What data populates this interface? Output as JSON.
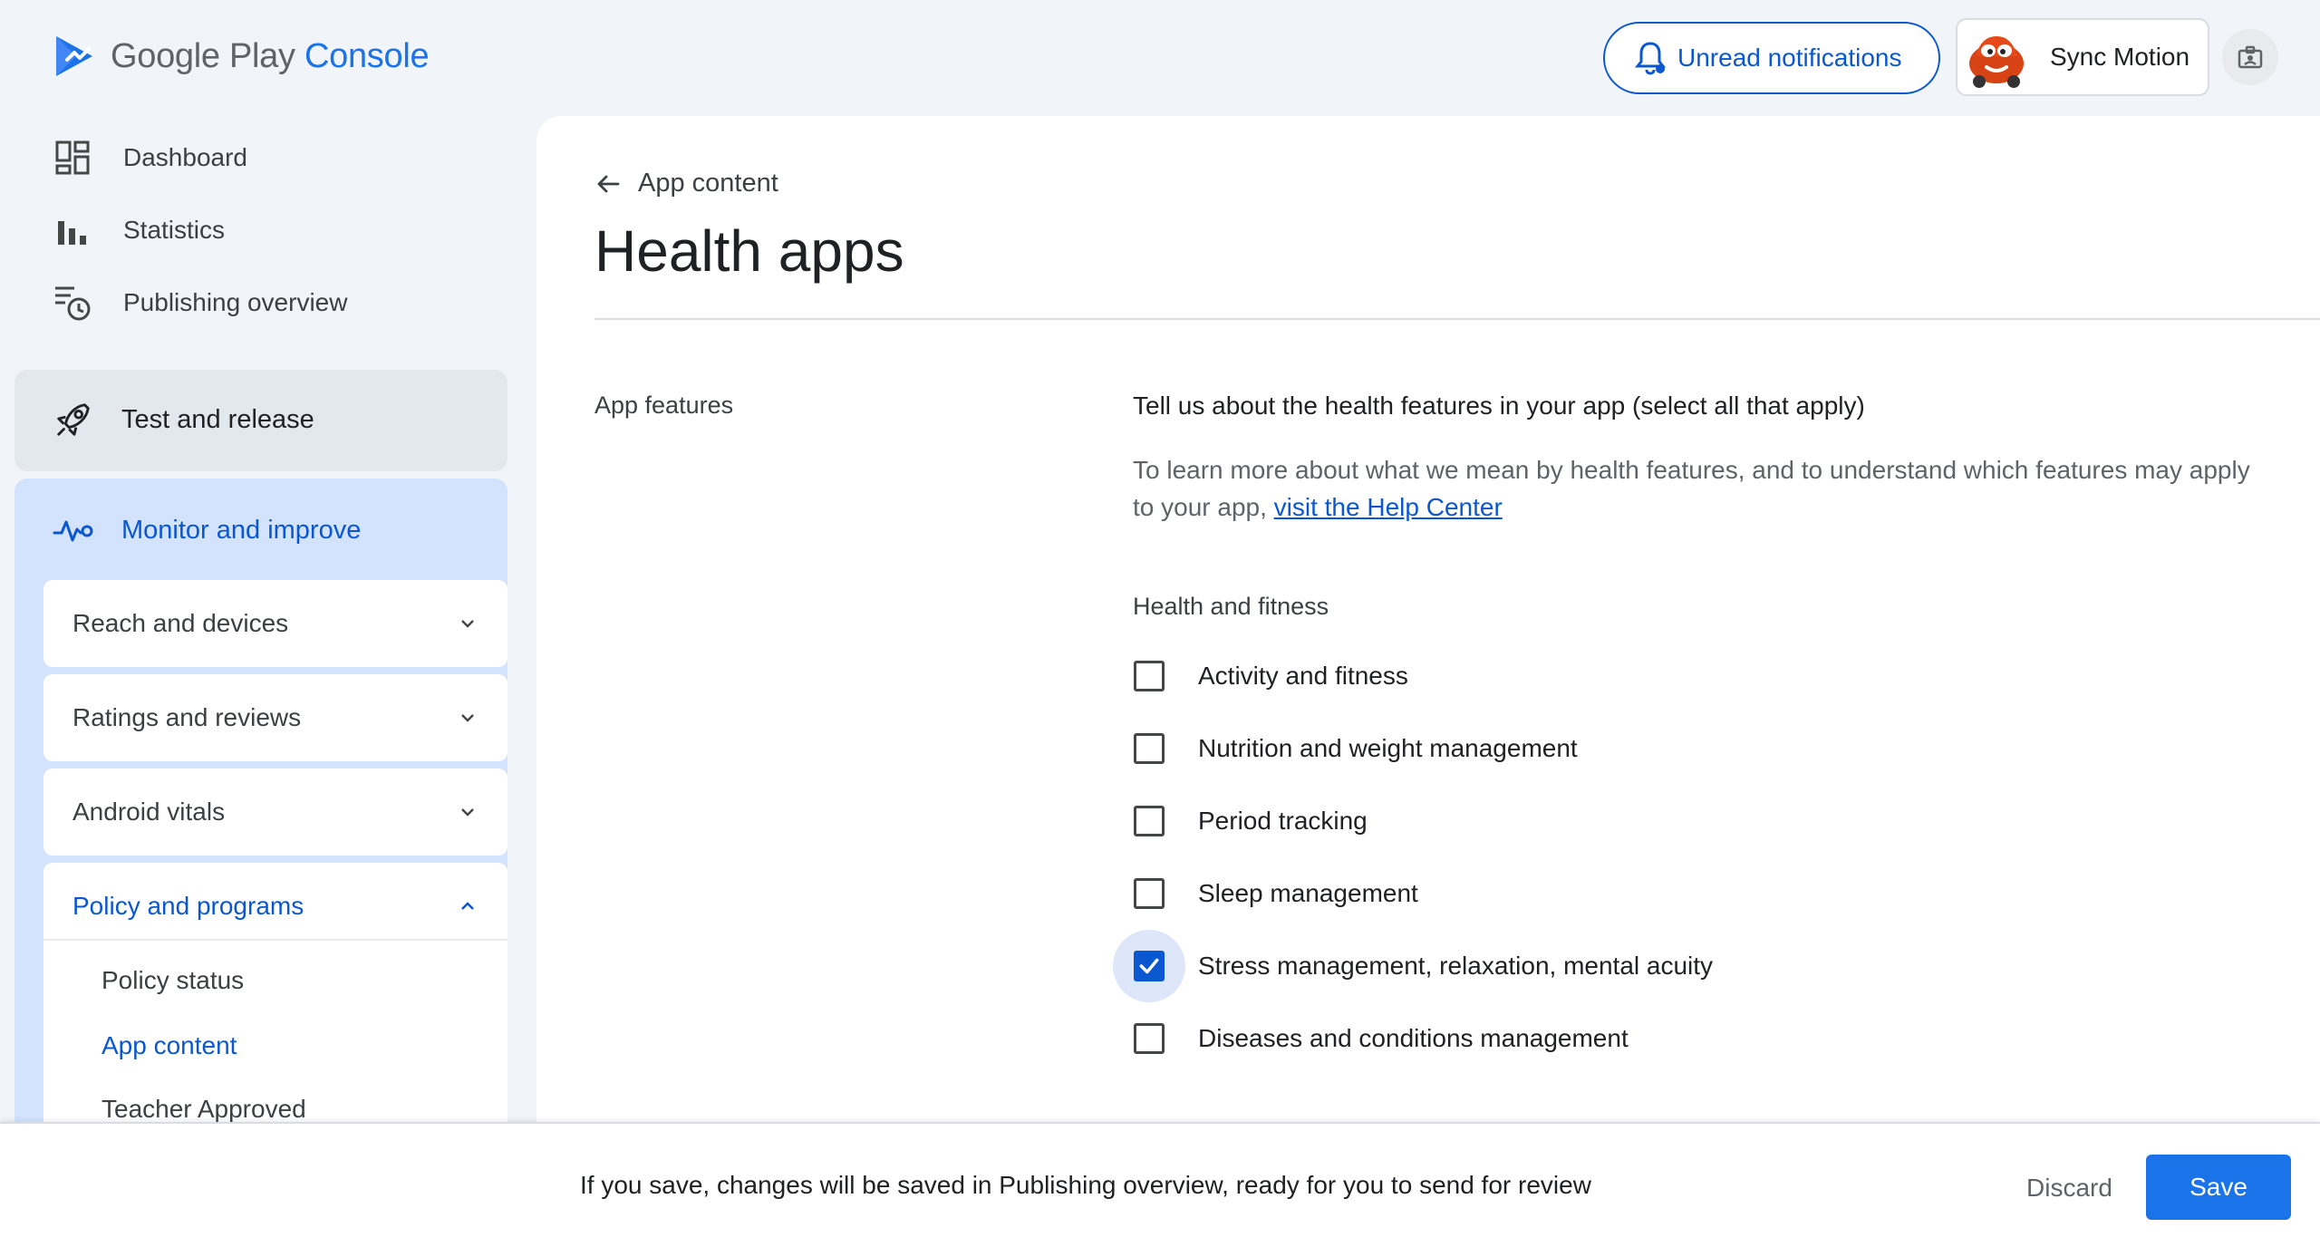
{
  "app": {
    "logo_google_play": "Google Play",
    "logo_console": "Console"
  },
  "header": {
    "notifications_label": "Unread notifications",
    "account_name": "Sync Motion",
    "notifications_icon": "bell-icon",
    "id_icon": "account-id-icon"
  },
  "sidebar": {
    "top_items": [
      {
        "label": "Dashboard",
        "icon": "dashboard-icon"
      },
      {
        "label": "Statistics",
        "icon": "bar-chart-icon"
      },
      {
        "label": "Publishing overview",
        "icon": "publishing-clock-icon"
      }
    ],
    "test_release": {
      "label": "Test and release",
      "icon": "rocket-icon"
    },
    "monitor": {
      "label": "Monitor and improve",
      "icon": "vitals-pulse-icon",
      "items": [
        {
          "label": "Reach and devices"
        },
        {
          "label": "Ratings and reviews"
        },
        {
          "label": "Android vitals"
        },
        {
          "label": "Policy and programs",
          "expanded": true
        }
      ],
      "policy_subitems": [
        {
          "label": "Policy status"
        },
        {
          "label": "App content",
          "active": true
        },
        {
          "label": "Teacher Approved"
        }
      ]
    }
  },
  "main": {
    "back_label": "App content",
    "title": "Health apps",
    "section_label": "App features",
    "question_title": "Tell us about the health features in your app (select all that apply)",
    "question_desc": "To learn more about what we mean by health features, and to understand which features may apply to your app,",
    "help_link": "visit the Help Center",
    "group_label": "Health and fitness",
    "options": [
      {
        "label": "Activity and fitness",
        "checked": false
      },
      {
        "label": "Nutrition and weight management",
        "checked": false
      },
      {
        "label": "Period tracking",
        "checked": false
      },
      {
        "label": "Sleep management",
        "checked": false
      },
      {
        "label": "Stress management, relaxation, mental acuity",
        "checked": true
      },
      {
        "label": "Diseases and conditions management",
        "checked": false
      }
    ]
  },
  "footer": {
    "message": "If you save, changes will be saved in Publishing overview, ready for you to send for review",
    "discard_label": "Discard",
    "save_label": "Save"
  },
  "colors": {
    "accent": "#0b57d0",
    "primary_button": "#1a73e8",
    "sidebar_active_bg": "#d3e3fd"
  }
}
